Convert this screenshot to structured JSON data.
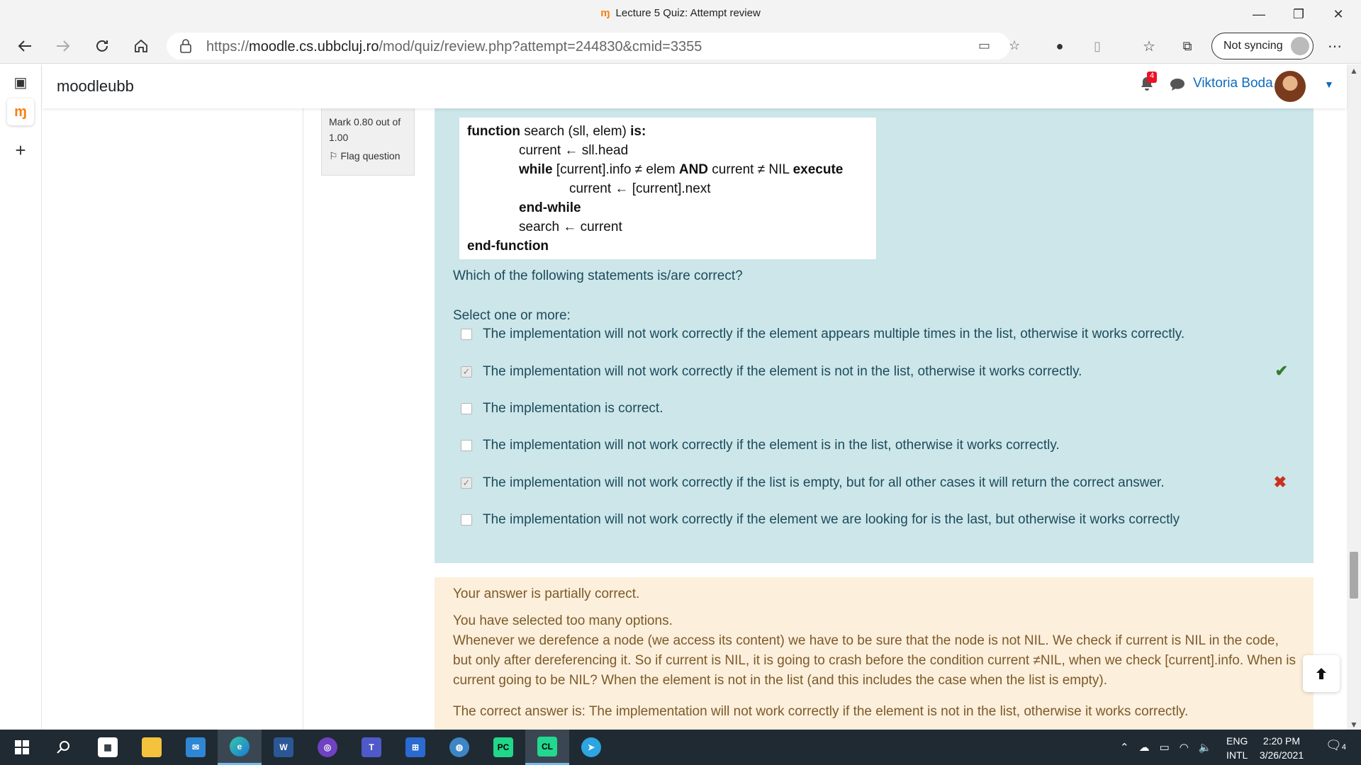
{
  "window": {
    "title": "Lecture 5 Quiz: Attempt review",
    "logo": "m"
  },
  "browser": {
    "url_prefix": "https://",
    "url_host": "moodle.cs.ubbcluj.ro",
    "url_path": "/mod/quiz/review.php?attempt=244830&cmid=3355",
    "sync_label": "Not syncing"
  },
  "header": {
    "brand": "moodleubb",
    "notification_count": "4",
    "user_name": "Viktoria Boda"
  },
  "question": {
    "mark": "Mark 0.80 out of 1.00",
    "flag_label": "Flag question",
    "code": {
      "line1_kw": "function",
      "line1_rest": " search (sll, elem) ",
      "line1_kw2": "is:",
      "line2": "current ← sll.head",
      "line3_kw": "while",
      "line3_mid": " [current].info ≠ elem ",
      "line3_kw2": "AND",
      "line3_mid2": " current ≠ NIL ",
      "line3_kw3": "execute",
      "line4": "current ← [current].next",
      "line5": "end-while",
      "line6": "search ← current",
      "line7": "end-function"
    },
    "text": "Which of the following statements is/are correct?",
    "prompt": "Select one or more:",
    "options": [
      {
        "label": "The implementation will not work correctly if the element appears multiple times in the list, otherwise it works correctly.",
        "checked": false
      },
      {
        "label": "The implementation will not work correctly if the element is not in the list, otherwise it works correctly.",
        "checked": true,
        "mark": "correct"
      },
      {
        "label": "The implementation is correct.",
        "checked": false
      },
      {
        "label": "The implementation will not work correctly if the element is in the list, otherwise it works correctly.",
        "checked": false
      },
      {
        "label": "The implementation will not work correctly if the list is empty, but for all other cases it will return the correct answer.",
        "checked": true,
        "mark": "incorrect"
      },
      {
        "label": "The implementation will not work correctly if the element we are looking for is the last, but otherwise it works correctly",
        "checked": false
      }
    ]
  },
  "feedback": {
    "summary": "Your answer is partially correct.",
    "detail1": "You have selected too many options.",
    "detail2": "Whenever we derefence a node (we access its content) we have to be sure that the node is not NIL. We check if current is NIL in the code, but only after dereferencing it. So if current is NIL, it is going to crash before the condition current ≠NIL, when we check [current].info. When is current going to be NIL? When the element is not in the list (and this includes the case when the list is empty).",
    "correct_answer": "The correct answer is: The implementation will not work correctly if the element is not in the list, otherwise it works correctly."
  },
  "taskbar": {
    "lang1": "ENG",
    "lang2": "INTL",
    "time": "2:20 PM",
    "date": "3/26/2021",
    "notifications": "4",
    "apps": [
      "start-icon",
      "search-icon",
      "store-icon",
      "file-explorer-icon",
      "mail-icon",
      "edge-icon",
      "word-icon",
      "github-icon",
      "teams-icon",
      "network-app-icon",
      "globe-icon",
      "pycharm-icon",
      "clion-icon",
      "telegram-icon"
    ]
  },
  "colors": {
    "accent": "#0f6cbf",
    "question_bg": "#cce6ea",
    "feedback_bg": "#fcefdc",
    "correct": "#357a32",
    "incorrect": "#ca3120"
  }
}
